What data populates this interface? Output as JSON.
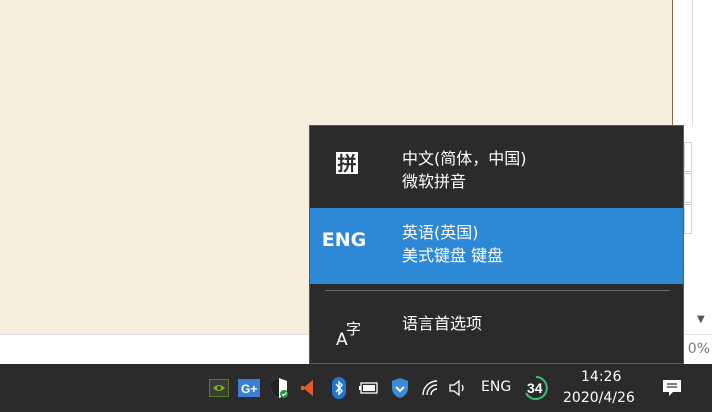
{
  "ime_flyout": {
    "items": [
      {
        "icon": "pinyin-icon",
        "icon_text": "拼",
        "title": "中文(简体，中国)",
        "subtitle": "微软拼音",
        "selected": false
      },
      {
        "icon": "eng-icon",
        "icon_text": "ENG",
        "title": "英语(英国)",
        "subtitle": "美式键盘 键盘",
        "selected": true
      }
    ],
    "language_preferences": {
      "icon": "language-icon",
      "icon_a": "A",
      "icon_zi": "字",
      "label": "语言首选项"
    }
  },
  "background": {
    "zoom_text": "0%"
  },
  "taskbar": {
    "tray_icons": [
      "nvidia-icon",
      "gplus-icon",
      "security-shield-icon",
      "volume-warning-icon",
      "bluetooth-icon",
      "battery-icon",
      "vpn-shield-icon",
      "wifi-icon",
      "speaker-icon"
    ],
    "language_indicator": "ENG",
    "badge_number": "34",
    "time": "14:26",
    "date": "2020/4/26",
    "notification_icon": "notification-icon"
  },
  "colors": {
    "flyout_bg": "#2b2b2b",
    "selected_bg": "#2d88d6",
    "taskbar_bg": "#2b2b2b",
    "app_bg": "#f7eedd"
  }
}
